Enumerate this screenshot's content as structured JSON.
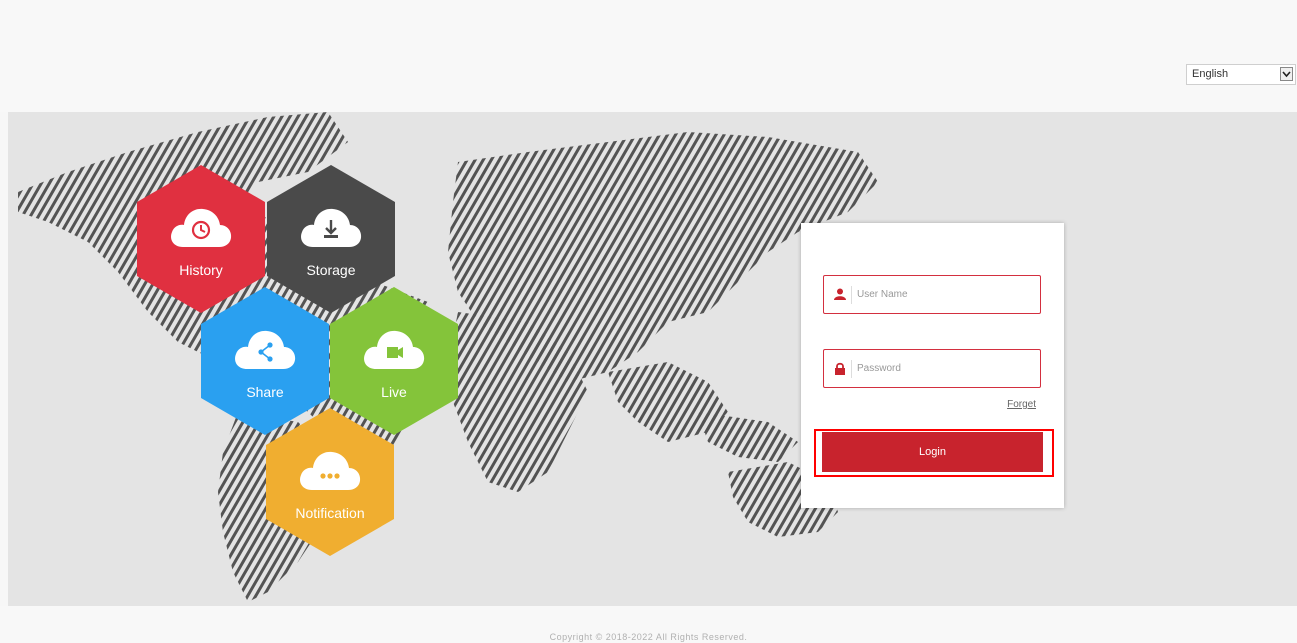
{
  "language": {
    "selected": "English"
  },
  "features": [
    {
      "label": "History",
      "icon": "history-icon",
      "color": "#e03040"
    },
    {
      "label": "Storage",
      "icon": "download-icon",
      "color": "#4a4a4a"
    },
    {
      "label": "Share",
      "icon": "share-icon",
      "color": "#2aa0f0"
    },
    {
      "label": "Live",
      "icon": "video-camera-icon",
      "color": "#84c43a"
    },
    {
      "label": "Notification",
      "icon": "ellipsis-icon",
      "color": "#f0ae30"
    }
  ],
  "login": {
    "username_placeholder": "User Name",
    "password_placeholder": "Password",
    "forget_label": "Forget",
    "login_label": "Login",
    "accent_color": "#c8232d"
  },
  "footer": {
    "copyright": "Copyright © 2018-2022 All Rights Reserved."
  }
}
